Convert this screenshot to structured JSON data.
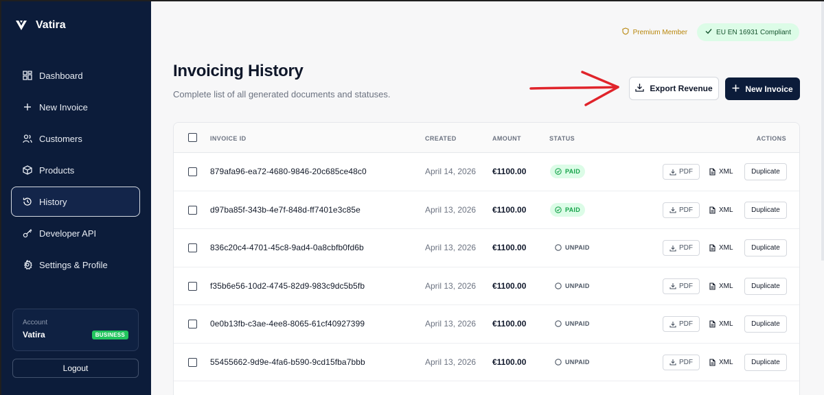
{
  "sidebar": {
    "brand": "Vatira",
    "items": [
      {
        "label": "Dashboard",
        "icon": "dashboard-grid-icon"
      },
      {
        "label": "New Invoice",
        "icon": "plus-icon"
      },
      {
        "label": "Customers",
        "icon": "users-icon"
      },
      {
        "label": "Products",
        "icon": "box-icon"
      },
      {
        "label": "History",
        "icon": "history-icon",
        "active": true
      },
      {
        "label": "Developer API",
        "icon": "key-icon"
      },
      {
        "label": "Settings & Profile",
        "icon": "gear-icon"
      }
    ],
    "account": {
      "label": "Account",
      "name": "Vatira",
      "plan": "BUSINESS"
    },
    "logout": "Logout"
  },
  "badges": {
    "premium": "Premium Member",
    "compliant": "EU EN 16931 Compliant"
  },
  "header": {
    "title": "Invoicing History",
    "subtitle": "Complete list of all generated documents and statuses.",
    "export_label": "Export Revenue",
    "new_label": "New Invoice"
  },
  "table": {
    "columns": {
      "id": "INVOICE ID",
      "created": "CREATED",
      "amount": "AMOUNT",
      "status": "STATUS",
      "actions": "ACTIONS"
    },
    "actions": {
      "pdf": "PDF",
      "xml": "XML",
      "duplicate": "Duplicate"
    },
    "rows": [
      {
        "id": "879afa96-ea72-4680-9846-20c685ce48c0",
        "created": "April 14, 2026",
        "amount": "€1100.00",
        "status": "PAID"
      },
      {
        "id": "d97ba85f-343b-4e7f-848d-ff7401e3c85e",
        "created": "April 13, 2026",
        "amount": "€1100.00",
        "status": "PAID"
      },
      {
        "id": "836c20c4-4701-45c8-9ad4-0a8cbfb0fd6b",
        "created": "April 13, 2026",
        "amount": "€1100.00",
        "status": "UNPAID"
      },
      {
        "id": "f35b6e56-10d2-4745-82d9-983c9dc5b5fb",
        "created": "April 13, 2026",
        "amount": "€1100.00",
        "status": "UNPAID"
      },
      {
        "id": "0e0b13fb-c3ae-4ee8-8065-61cf40927399",
        "created": "April 13, 2026",
        "amount": "€1100.00",
        "status": "UNPAID"
      },
      {
        "id": "55455662-9d9e-4fa6-b590-9cd15fba7bbb",
        "created": "April 13, 2026",
        "amount": "€1100.00",
        "status": "UNPAID"
      }
    ]
  },
  "colors": {
    "sidebar_bg": "#0c1c3a",
    "primary": "#0c1c3a",
    "paid": "#16a34a",
    "annotation_arrow": "#e0242b"
  }
}
